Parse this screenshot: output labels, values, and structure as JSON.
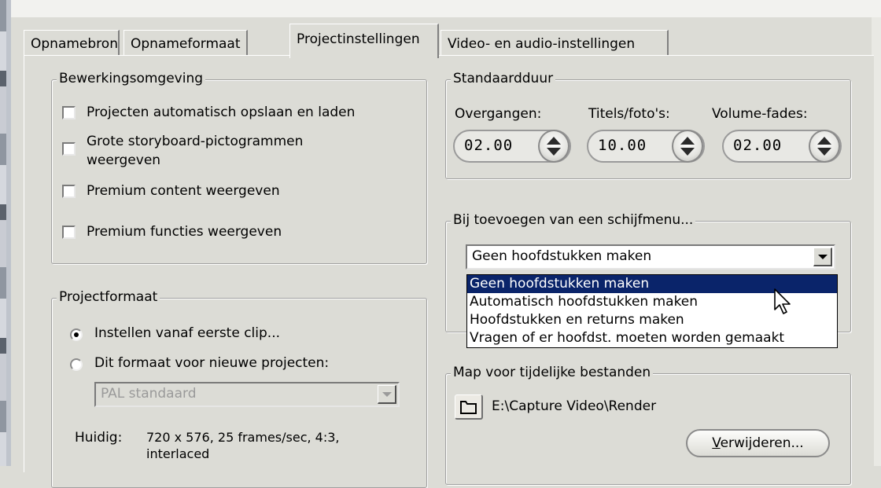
{
  "tabs": [
    "Opnamebron",
    "Opnameformaat",
    "Projectinstellingen",
    "Video- en audio-instellingen"
  ],
  "active_tab": "Projectinstellingen",
  "editing": {
    "legend": "Bewerkingsomgeving",
    "options": [
      {
        "label": "Projecten automatisch opslaan en laden",
        "checked": false
      },
      {
        "label_line1": "Grote storyboard-pictogrammen",
        "label_line2": "weergeven",
        "checked": false
      },
      {
        "label": "Premium content weergeven",
        "checked": false
      },
      {
        "label": "Premium functies weergeven",
        "checked": false
      }
    ]
  },
  "duration": {
    "legend": "Standaardduur",
    "fields": [
      {
        "label": "Overgangen:",
        "value": "02.00"
      },
      {
        "label": "Titels/foto's:",
        "value": "10.00"
      },
      {
        "label": "Volume-fades:",
        "value": "02.00"
      }
    ]
  },
  "disc_menu": {
    "legend": "Bij toevoegen van een schijfmenu...",
    "selected": "Geen hoofdstukken maken",
    "options": [
      "Geen hoofdstukken maken",
      "Automatisch hoofdstukken maken",
      "Hoofdstukken en returns maken",
      "Vragen of er hoofdst. moeten worden gemaakt"
    ],
    "highlighted_index": 0
  },
  "project_format": {
    "legend": "Projectformaat",
    "radio1": "Instellen vanaf eerste clip...",
    "radio2": "Dit formaat voor nieuwe projecten:",
    "selected_radio": 1,
    "format_value": "PAL standaard",
    "current_label": "Huidig:",
    "current_line1": "720 x 576, 25 frames/sec, 4:3,",
    "current_line2": "interlaced"
  },
  "temp_folder": {
    "legend": "Map voor tijdelijke bestanden",
    "path": "E:\\Capture Video\\Render",
    "delete_button_first": "V",
    "delete_button_rest": "erwijderen..."
  },
  "icons": [
    "checkbox",
    "radio-button",
    "spinner-arrows-icon",
    "combo-arrow-icon",
    "folder-icon",
    "mouse-cursor-icon"
  ]
}
